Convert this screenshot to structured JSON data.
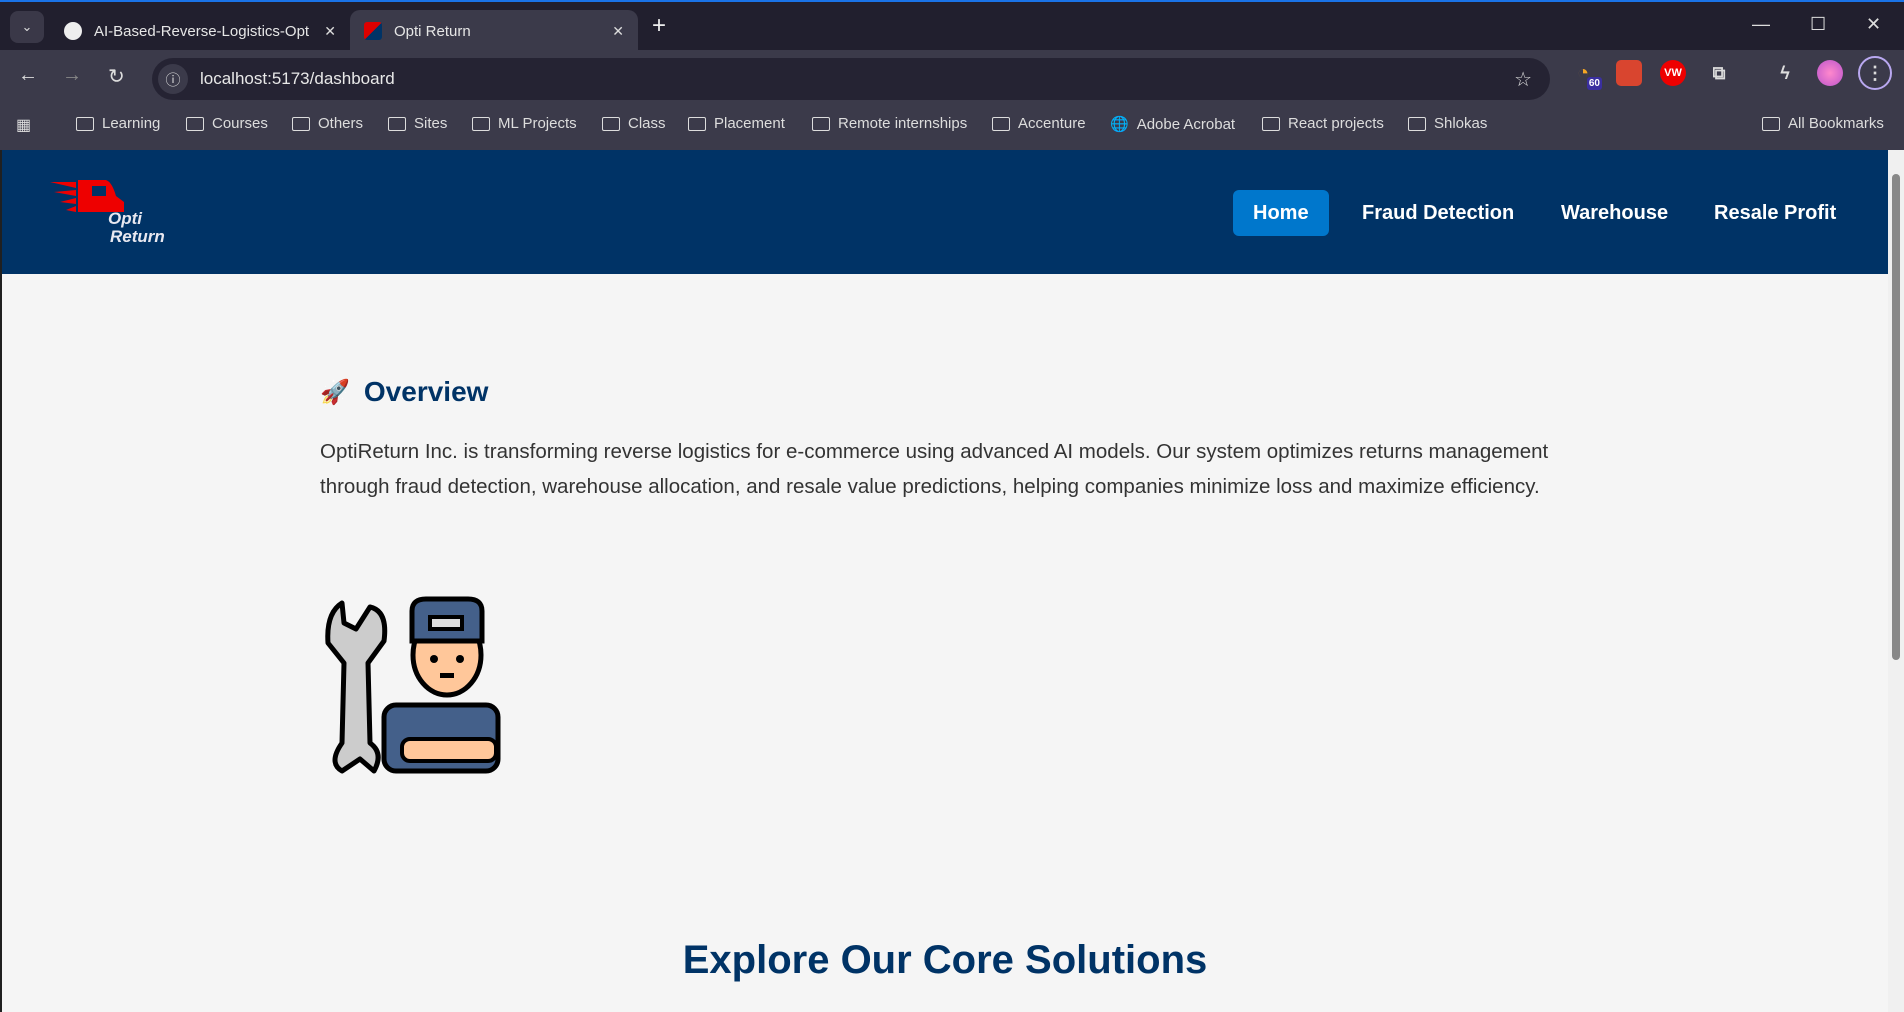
{
  "browser": {
    "tabs": [
      {
        "title": "AI-Based-Reverse-Logistics-Opt",
        "icon": "github-icon",
        "active": false
      },
      {
        "title": "Opti Return",
        "icon": "optireturn-favicon",
        "active": true
      }
    ],
    "url": "localhost:5173/dashboard",
    "extensions": [
      {
        "name": "rss-extension",
        "badge": "60"
      },
      {
        "name": "extension-red"
      },
      {
        "name": "extension-vw",
        "label": "VW"
      }
    ],
    "bookmarks": [
      "Learning",
      "Courses",
      "Others",
      "Sites",
      "ML Projects",
      "Class",
      "Placement",
      "Remote internships",
      "Accenture",
      "Adobe Acrobat",
      "React projects",
      "Shlokas"
    ],
    "all_bookmarks": "All Bookmarks"
  },
  "header": {
    "logo_text": "Opti Return",
    "nav": [
      {
        "label": "Home",
        "active": true
      },
      {
        "label": "Fraud Detection",
        "active": false
      },
      {
        "label": "Warehouse",
        "active": false
      },
      {
        "label": "Resale Profit",
        "active": false
      }
    ]
  },
  "overview": {
    "icon": "🚀",
    "title": "Overview",
    "text": "OptiReturn Inc. is transforming reverse logistics for e-commerce using advanced AI models. Our system optimizes returns management through fraud detection, warehouse allocation, and resale value predictions, helping companies minimize loss and maximize efficiency."
  },
  "solutions": {
    "title": "Explore Our Core Solutions"
  },
  "colors": {
    "header": "#003366",
    "accent": "#0077cc",
    "background": "#f5f5f5"
  }
}
